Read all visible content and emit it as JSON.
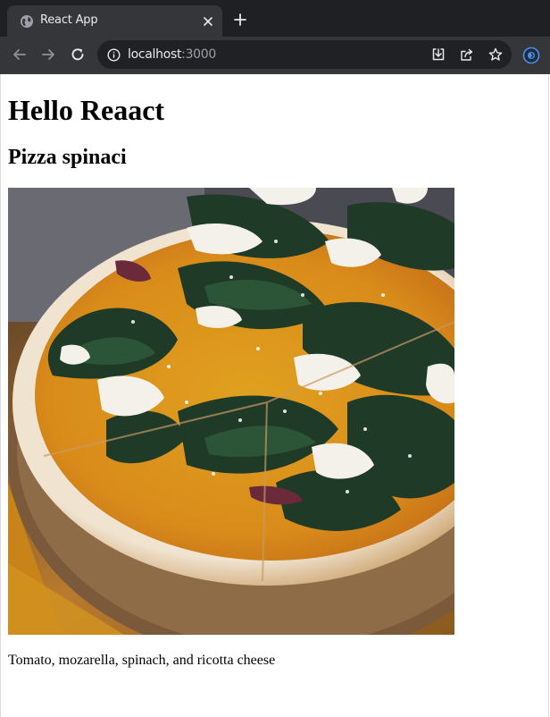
{
  "browser": {
    "tab_title": "React App",
    "url_host": "localhost",
    "url_port": ":3000",
    "icons": {
      "tab_favicon": "globe-icon",
      "tab_close": "close-icon",
      "new_tab": "plus-icon",
      "back": "arrow-left-icon",
      "forward": "arrow-right-icon",
      "reload": "reload-icon",
      "site_info": "info-icon",
      "install": "install-icon",
      "share": "share-icon",
      "bookmark": "star-icon",
      "extension": "extension-icon"
    },
    "colors": {
      "frame": "#1f2023",
      "toolbar": "#35363a",
      "omnibox": "#202124",
      "text": "#e8eaed",
      "muted_text": "#9aa0a6",
      "extension_accent": "#4a90e2"
    }
  },
  "page": {
    "heading": "Hello Reaact",
    "pizza_name": "Pizza spinaci",
    "pizza_ingredients": "Tomato, mozarella, spinach, and ricotta cheese",
    "image_subject": "pizza-spinaci-photo"
  }
}
